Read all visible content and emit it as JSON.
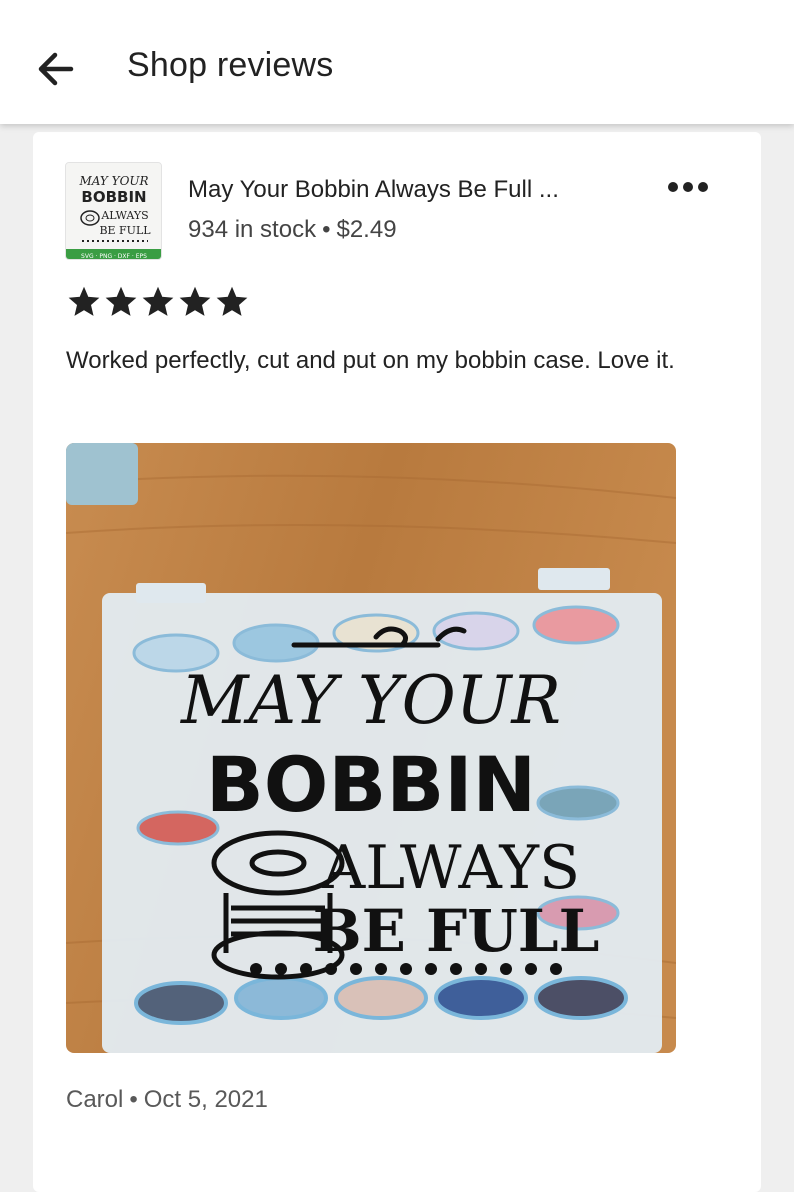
{
  "header": {
    "title": "Shop reviews",
    "back_icon": "arrow-left-icon"
  },
  "listing": {
    "title": "May Your Bobbin Always Be Full ...",
    "stock": "934 in stock",
    "separator": "•",
    "price": "$2.49",
    "thumb_text": {
      "line1": "MAY YOUR",
      "line2": "BOBBIN",
      "line3": "ALWAYS",
      "line4": "BE FULL",
      "footer": "SVG · PNG · DXF · EPS"
    },
    "more_icon": "more-horizontal-icon"
  },
  "review": {
    "rating": 5,
    "rating_max": 5,
    "text": "Worked perfectly, cut and put on my bobbin case. Love it.",
    "photo_text": {
      "line1": "MAY YOUR",
      "line2": "BOBBIN",
      "line3": "ALWAYS",
      "line4": "BE FULL"
    },
    "reviewer": "Carol",
    "separator": "•",
    "date": "Oct 5, 2021"
  },
  "colors": {
    "star": "#222222",
    "thumb_footer": "#3a9d43",
    "wood": "#c1844a"
  }
}
